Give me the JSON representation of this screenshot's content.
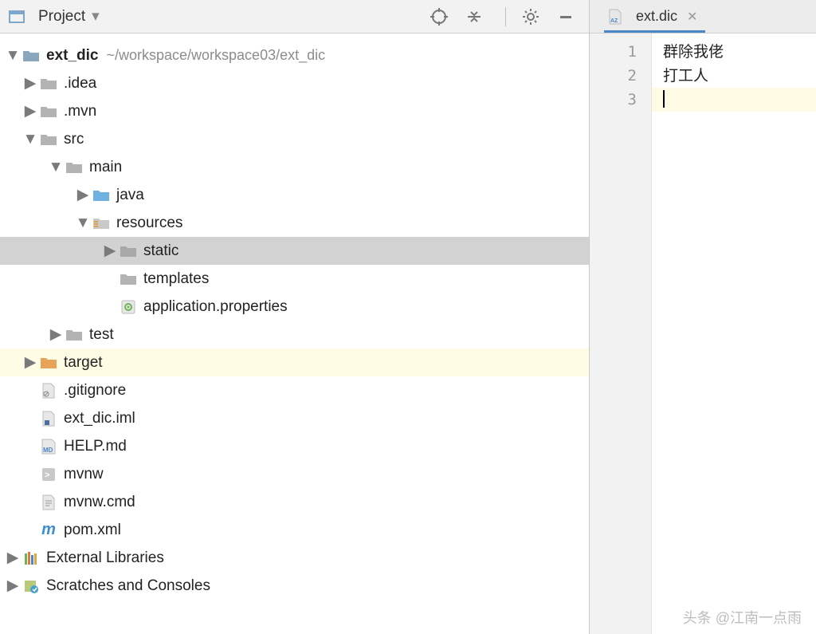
{
  "header": {
    "title": "Project"
  },
  "tree": {
    "root": {
      "name": "ext_dic",
      "path": "~/workspace/workspace03/ext_dic"
    },
    "idea": ".idea",
    "mvn": ".mvn",
    "src": "src",
    "main": "main",
    "java": "java",
    "resources": "resources",
    "static": "static",
    "templates": "templates",
    "appprops": "application.properties",
    "test": "test",
    "target": "target",
    "gitignore": ".gitignore",
    "iml": "ext_dic.iml",
    "help": "HELP.md",
    "mvnw": "mvnw",
    "mvnwcmd": "mvnw.cmd",
    "pom": "pom.xml",
    "extlib": "External Libraries",
    "scratch": "Scratches and Consoles"
  },
  "tab": {
    "name": "ext.dic"
  },
  "editor": {
    "lines": [
      "群除我佬",
      "打工人",
      ""
    ],
    "gutter": [
      "1",
      "2",
      "3"
    ]
  },
  "watermark": "头条 @江南一点雨"
}
